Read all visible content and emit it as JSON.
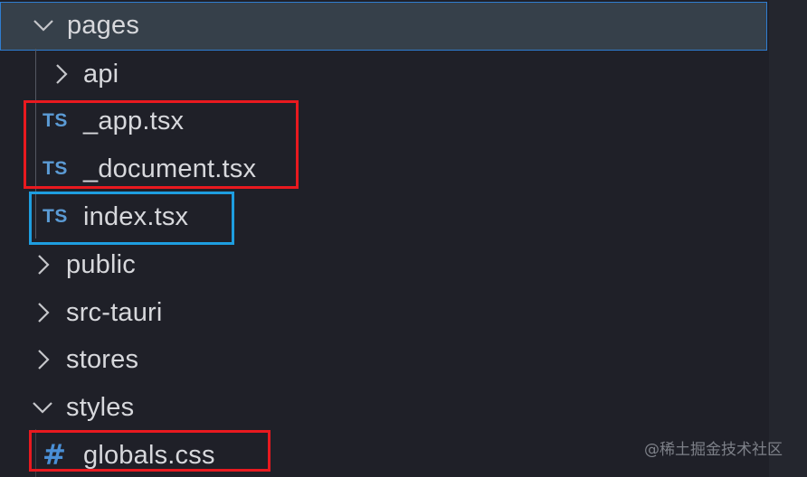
{
  "tree": {
    "items": [
      {
        "label": "pages",
        "type": "folder",
        "expanded": true,
        "selected": true,
        "icon": "chevron-down-icon"
      },
      {
        "label": "api",
        "type": "folder",
        "expanded": false,
        "icon": "chevron-right-icon"
      },
      {
        "label": "_app.tsx",
        "type": "file",
        "icon_text": "TS",
        "icon": "typescript-icon"
      },
      {
        "label": "_document.tsx",
        "type": "file",
        "icon_text": "TS",
        "icon": "typescript-icon"
      },
      {
        "label": "index.tsx",
        "type": "file",
        "icon_text": "TS",
        "icon": "typescript-icon"
      },
      {
        "label": "public",
        "type": "folder",
        "expanded": false,
        "icon": "chevron-right-icon"
      },
      {
        "label": "src-tauri",
        "type": "folder",
        "expanded": false,
        "icon": "chevron-right-icon"
      },
      {
        "label": "stores",
        "type": "folder",
        "expanded": false,
        "icon": "chevron-right-icon"
      },
      {
        "label": "styles",
        "type": "folder",
        "expanded": true,
        "icon": "chevron-down-icon"
      },
      {
        "label": "globals.css",
        "type": "file",
        "icon_text": "#",
        "icon": "css-icon"
      }
    ]
  },
  "annotations": {
    "red_highlight_color": "#e8191f",
    "blue_highlight_color": "#1e9ee0"
  },
  "watermark": {
    "text": "@稀土掘金技术社区"
  },
  "colors": {
    "background": "#1f2028",
    "selection_background": "#36404a",
    "selection_border": "#2f7dd0",
    "typescript_icon": "#5b9bd5",
    "css_icon": "#4a8fd6"
  }
}
